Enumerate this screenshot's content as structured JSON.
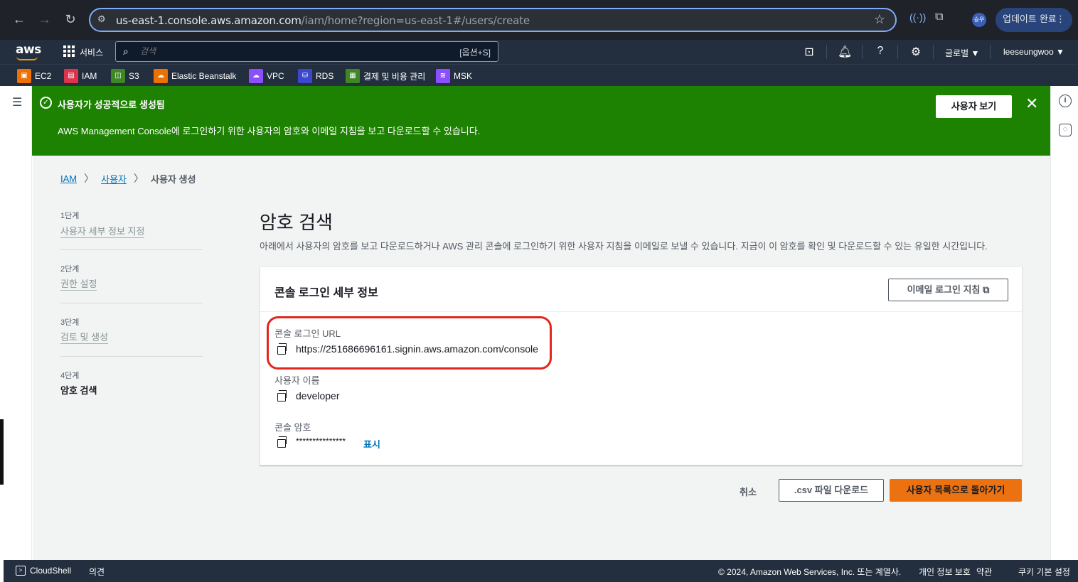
{
  "browser": {
    "url_host": "us-east-1.console.aws.amazon.com",
    "url_path": "/iam/home?region=us-east-1#/users/create",
    "update_label": "업데이트 완료",
    "profile_initials": "승우"
  },
  "topnav": {
    "logo": "aws",
    "services_label": "서비스",
    "search_placeholder": "검색",
    "search_shortcut": "[옵션+S]",
    "region_label": "글로벌 ▼",
    "account_label": "leeseungwoo ▼"
  },
  "favorites": [
    {
      "label": "EC2",
      "color": "#ed7100"
    },
    {
      "label": "IAM",
      "color": "#dd344c"
    },
    {
      "label": "S3",
      "color": "#3f8624"
    },
    {
      "label": "Elastic Beanstalk",
      "color": "#ed7100"
    },
    {
      "label": "VPC",
      "color": "#8c4fff"
    },
    {
      "label": "RDS",
      "color": "#3b48cc"
    },
    {
      "label": "결제 및 비용 관리",
      "color": "#3f8624"
    },
    {
      "label": "MSK",
      "color": "#8c4fff"
    }
  ],
  "flash": {
    "title": "사용자가 성공적으로 생성됨",
    "description": "AWS Management Console에 로그인하기 위한 사용자의 암호와 이메일 지침을 보고 다운로드할 수 있습니다.",
    "view_button": "사용자 보기",
    "close": "✕",
    "color": "#1d8102"
  },
  "breadcrumb": {
    "root": "IAM",
    "parent": "사용자",
    "current": "사용자 생성"
  },
  "steps": [
    {
      "num": "1단계",
      "label": "사용자 세부 정보 지정"
    },
    {
      "num": "2단계",
      "label": "권한 설정"
    },
    {
      "num": "3단계",
      "label": "검토 및 생성"
    },
    {
      "num": "4단계",
      "label": "암호 검색"
    }
  ],
  "page": {
    "title": "암호 검색",
    "description": "아래에서 사용자의 암호를 보고 다운로드하거나 AWS 관리 콘솔에 로그인하기 위한 사용자 지침을 이메일로 보낼 수 있습니다. 지금이 이 암호를 확인 및 다운로드할 수 있는 유일한 시간입니다."
  },
  "panel": {
    "title": "콘솔 로그인 세부 정보",
    "email_button": "이메일 로그인 지침",
    "url_label": "콘솔 로그인 URL",
    "url_value": "https://251686696161.signin.aws.amazon.com/console",
    "username_label": "사용자 이름",
    "username_value": "developer",
    "password_label": "콘솔 암호",
    "password_value": "***************",
    "show_link": "표시"
  },
  "actions": {
    "cancel": "취소",
    "csv": ".csv 파일 다운로드",
    "primary": "사용자 목록으로 돌아가기",
    "primary_color": "#ec7211"
  },
  "footer": {
    "cloudshell": "CloudShell",
    "feedback": "의견",
    "copyright": "© 2024, Amazon Web Services, Inc. 또는 계열사.",
    "privacy": "개인 정보 보호",
    "terms": "약관",
    "cookies": "쿠키 기본 설정"
  }
}
